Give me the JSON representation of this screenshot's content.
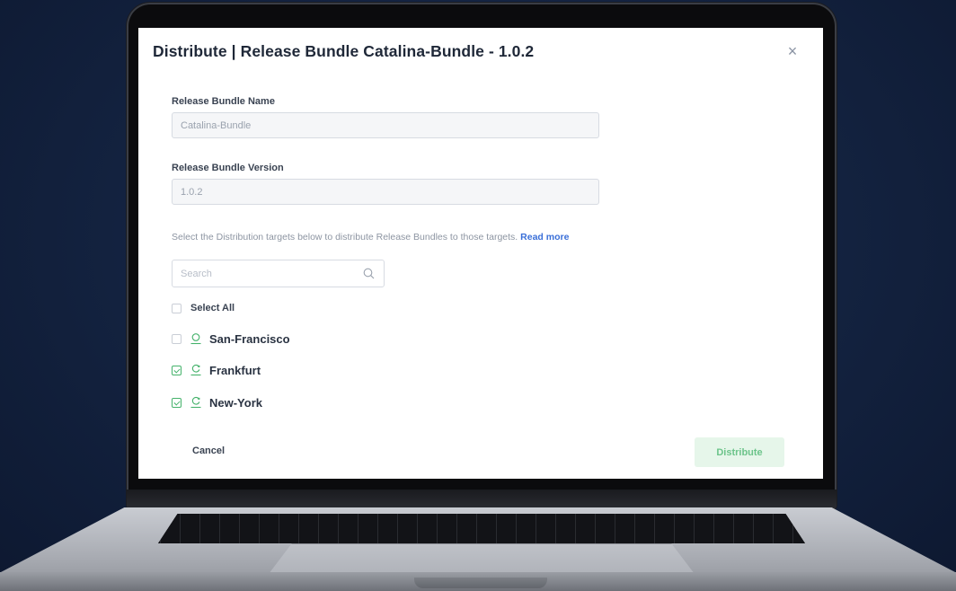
{
  "dialog": {
    "title": "Distribute | Release Bundle Catalina-Bundle - 1.0.2",
    "close_glyph": "×"
  },
  "form": {
    "name_label": "Release Bundle Name",
    "name_value": "Catalina-Bundle",
    "version_label": "Release Bundle Version",
    "version_value": "1.0.2",
    "helper_text": "Select the Distribution targets below to distribute Release Bundles to those targets.",
    "read_more": "Read more"
  },
  "search": {
    "placeholder": "Search",
    "icon": "search-icon"
  },
  "select_all": {
    "label": "Select All",
    "checked": false
  },
  "targets": [
    {
      "label": "San-Francisco",
      "checked": false,
      "icon": "node-icon"
    },
    {
      "label": "Frankfurt",
      "checked": true,
      "icon": "node-sync-icon"
    },
    {
      "label": "New-York",
      "checked": true,
      "icon": "node-sync-icon"
    }
  ],
  "actions": {
    "cancel_label": "Cancel",
    "distribute_label": "Distribute"
  },
  "colors": {
    "accent_green": "#45b26b",
    "link_blue": "#3a6fd8",
    "distribute_bg": "#e6f6ea"
  }
}
